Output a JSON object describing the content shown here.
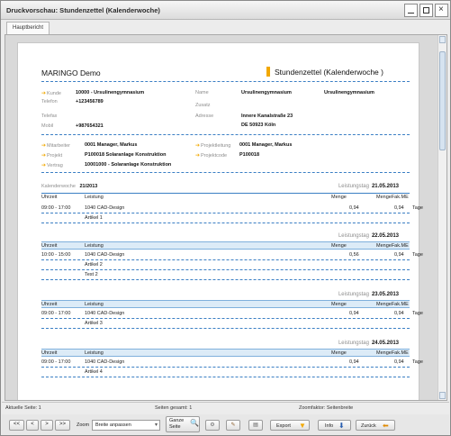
{
  "window": {
    "title": "Druckvorschau: Stundenzettel (Kalenderwoche)"
  },
  "tabs": [
    {
      "label": "Hauptbericht"
    }
  ],
  "report": {
    "company": "MARINGO Demo",
    "doc_title": "Stundenzettel  (Kalenderwoche )",
    "customer": {
      "kunde_label": "Kunde",
      "kunde_value": "10000 - Ursulinengymnasium",
      "telefon_label": "Telefon",
      "telefon_value": "+123456789",
      "telefax_label": "Telefax",
      "telefax_value": "",
      "mobil_label": "Mobil",
      "mobil_value": "+987654321",
      "name_label": "Name",
      "name_value": "Ursulinengymnasium",
      "name_value2": "Ursulinengymnasium",
      "zusatz_label": "Zusatz",
      "zusatz_value": "",
      "adresse_label": "Adresse",
      "adresse_line1": "Innere Kanalstraße 23",
      "adresse_line2": "DE 50923 Köln"
    },
    "project": {
      "mitarbeiter_label": "Mitarbeiter",
      "mitarbeiter_value": "0001 Manager, Markus",
      "projekt_label": "Projekt",
      "projekt_value": "P100018 Solaranlage Konstruktion",
      "vertrag_label": "Vertrag",
      "vertrag_value": "10001000 - Solaranlage Konstruktion",
      "projektleitung_label": "Projektleitung",
      "projektleitung_value": "0001 Manager, Markus",
      "projektcode_label": "Projektcode",
      "projektcode_value": "P100018"
    },
    "kalenderwoche_label": "Kalenderwoche",
    "kalenderwoche_value": "21/2013",
    "leistungstag_label": "Leistungstag",
    "columns": {
      "uhrzeit": "Uhrzeit",
      "leistung": "Leistung",
      "menge": "Menge",
      "mengefakme": "MengeFak.ME"
    },
    "days": [
      {
        "date": "21.05.2013",
        "time": "09:00 - 17:00",
        "service": "1040 CAD-Design",
        "menge": "0,94",
        "fak": "0,94",
        "unit": "Tage",
        "article": "Artikel 1",
        "note": ""
      },
      {
        "date": "22.05.2013",
        "time": "10:00 - 15:00",
        "service": "1040 CAD-Design",
        "menge": "0,56",
        "fak": "0,94",
        "unit": "Tage",
        "article": "Artikel 2",
        "note": "Test 2"
      },
      {
        "date": "23.05.2013",
        "time": "09:00 - 17:00",
        "service": "1040 CAD-Design",
        "menge": "0,94",
        "fak": "0,94",
        "unit": "Tage",
        "article": "Artikel 3",
        "note": ""
      },
      {
        "date": "24.05.2013",
        "time": "09:00 - 17:00",
        "service": "1040 CAD-Design",
        "menge": "0,94",
        "fak": "0,94",
        "unit": "Tage",
        "article": "Artikel 4",
        "note": ""
      }
    ]
  },
  "status": {
    "current_page": "Aktuelle Seite: 1",
    "pages_total": "Seiten gesamt: 1",
    "zoom_factor": "Zoomfaktor: Seitenbreite"
  },
  "toolbar": {
    "first": "<<",
    "prev": "<",
    "next": ">",
    "last": ">>",
    "zoom_label": "Zoom",
    "zoom_value": "Breite anpassen",
    "whole_page_line1": "Ganze",
    "whole_page_line2": "Seite",
    "export": "Export",
    "info": "Info",
    "back": "Zurück"
  },
  "colors": {
    "accent": "#f2a800",
    "line": "#3b7fc4",
    "table_head": "#dcebf7"
  }
}
